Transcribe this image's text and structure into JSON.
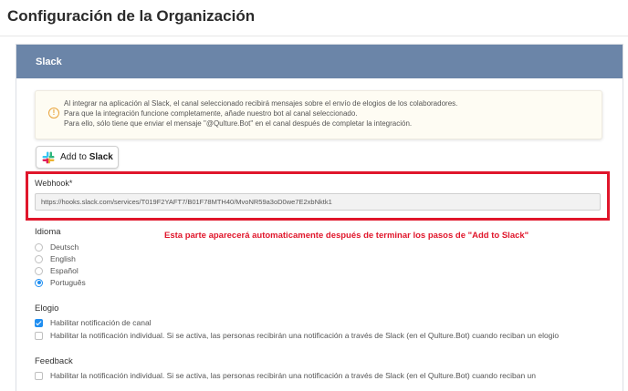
{
  "page": {
    "title": "Configuración de la Organización"
  },
  "card": {
    "header": "Slack"
  },
  "info": {
    "icon": "warning-circle-icon",
    "line1": "Al integrar na aplicación al Slack, el canal seleccionado recibirá mensajes sobre el envío de elogios de los colaboradores.",
    "line2": "Para que la integración funcione completamente, añade nuestro bot al canal seleccionado.",
    "line3": "Para ello, sólo tiene que enviar el mensaje \"@Qulture.Bot\" en el canal después de completar la integración."
  },
  "slack_button": {
    "prefix": "Add to ",
    "brand": "Slack",
    "icon": "slack-logo-icon"
  },
  "webhook": {
    "label": "Webhook",
    "required_mark": "*",
    "value": "https://hooks.slack.com/services/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"
  },
  "annotation": {
    "text": "Esta parte aparecerá automaticamente después de terminar los pasos de \"Add to Slack\"",
    "color": "#e0162b"
  },
  "language": {
    "label": "Idioma",
    "options": [
      "Deutsch",
      "English",
      "Español",
      "Português"
    ],
    "selected": "Português"
  },
  "elogio": {
    "label": "Elogio",
    "options": [
      {
        "label": "Habilitar notificación de canal",
        "checked": true
      },
      {
        "label": "Habilitar la notificación individual. Si se activa, las personas recibirán una notificación a través de Slack (en el Qulture.Bot) cuando reciban un elogio",
        "checked": false
      }
    ]
  },
  "feedback": {
    "label": "Feedback",
    "options": [
      {
        "label": "Habilitar la notificación individual. Si se activa, las personas recibirán una notificación a través de Slack (en el Qulture.Bot) cuando reciban un",
        "checked": false
      }
    ]
  },
  "colors": {
    "header": "#6b85a8",
    "accent": "#1f8ef1",
    "highlight": "#e0162b"
  }
}
